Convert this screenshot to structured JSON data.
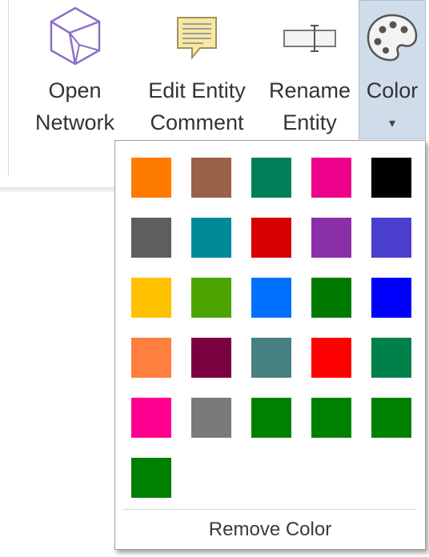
{
  "ribbon": {
    "buttons": [
      {
        "line1": "Open",
        "line2": "Network",
        "icon": "open-network-icon"
      },
      {
        "line1": "Edit Entity",
        "line2": "Comment",
        "icon": "comment-icon"
      },
      {
        "line1": "Rename",
        "line2": "Entity",
        "icon": "rename-icon"
      },
      {
        "line1": "Color",
        "caret": "▾",
        "icon": "palette-icon"
      }
    ]
  },
  "color_menu": {
    "swatches": [
      "#ff7b00",
      "#9a6048",
      "#00805a",
      "#ef008c",
      "#000000",
      "#5e5e5e",
      "#008a99",
      "#d80000",
      "#8a2fa8",
      "#4b3ecc",
      "#ffc000",
      "#4ca400",
      "#0071ff",
      "#007a00",
      "#0000ff",
      "#ff7f3f",
      "#7a0040",
      "#468080",
      "#ff0000",
      "#00804a",
      "#ff0090",
      "#7a7a7a",
      "#008000",
      "#008000",
      "#008000",
      "#008000"
    ],
    "remove_label": "Remove Color"
  }
}
